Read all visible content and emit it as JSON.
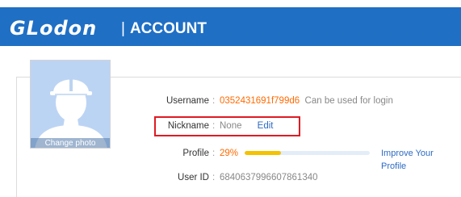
{
  "header": {
    "logo_text": "GLodon",
    "separator": "|",
    "section_title": "ACCOUNT"
  },
  "avatar": {
    "icon": "person-hardhat-icon",
    "change_photo_label": "Change photo"
  },
  "profile": {
    "username": {
      "label": "Username",
      "colon": ":",
      "value": "0352431691f799d6",
      "note": "Can be used for login"
    },
    "nickname": {
      "label": "Nickname",
      "colon": ":",
      "value": "None",
      "edit_label": "Edit"
    },
    "completion": {
      "label": "Profile",
      "colon": ":",
      "percent_text": "29%",
      "percent": 29,
      "improve_label": "Improve Your Profile"
    },
    "user_id": {
      "label": "User ID",
      "colon": ":",
      "value": "6840637996607861340"
    }
  },
  "colors": {
    "header_bg": "#1f6fc5",
    "accent_orange": "#ff6a00",
    "link_blue": "#2d6bc4",
    "highlight_red": "#e01b24",
    "progress_fill": "#f5c200"
  }
}
